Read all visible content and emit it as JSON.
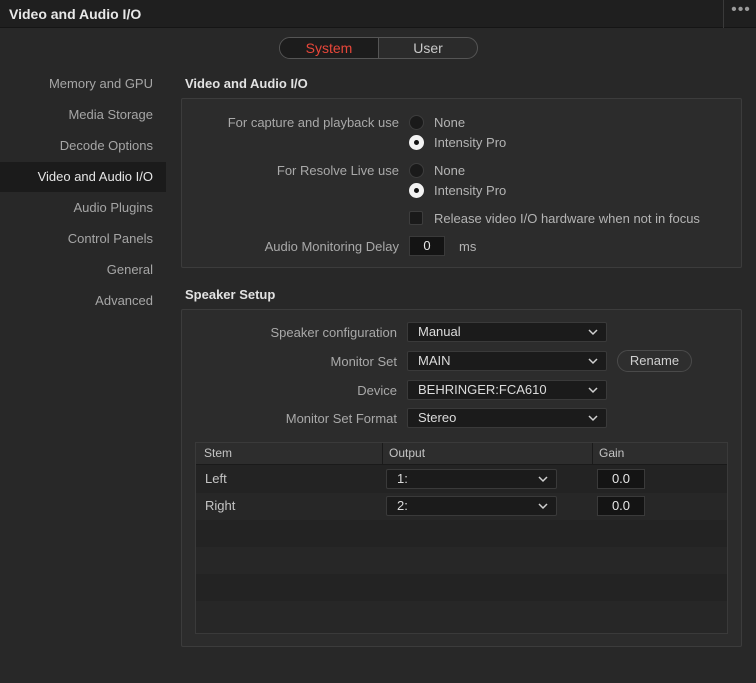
{
  "window": {
    "title": "Video and Audio I/O",
    "more_label": "•••"
  },
  "tabs": {
    "system": "System",
    "user": "User",
    "active": "System"
  },
  "sidebar": {
    "items": [
      {
        "label": "Memory and GPU"
      },
      {
        "label": "Media Storage"
      },
      {
        "label": "Decode Options"
      },
      {
        "label": "Video and Audio I/O",
        "active": true
      },
      {
        "label": "Audio Plugins"
      },
      {
        "label": "Control Panels"
      },
      {
        "label": "General"
      },
      {
        "label": "Advanced"
      }
    ]
  },
  "io": {
    "title": "Video and Audio I/O",
    "capture_label": "For capture and playback use",
    "capture_options": [
      {
        "label": "None",
        "selected": false
      },
      {
        "label": "Intensity Pro",
        "selected": true
      }
    ],
    "live_label": "For Resolve Live use",
    "live_options": [
      {
        "label": "None",
        "selected": false
      },
      {
        "label": "Intensity Pro",
        "selected": true
      }
    ],
    "release_label": "Release video I/O hardware when not in focus",
    "release_checked": false,
    "delay_label": "Audio Monitoring Delay",
    "delay_value": "0",
    "delay_unit": "ms"
  },
  "speaker": {
    "title": "Speaker Setup",
    "config_label": "Speaker configuration",
    "config_value": "Manual",
    "monitor_set_label": "Monitor Set",
    "monitor_set_value": "MAIN",
    "rename_label": "Rename",
    "device_label": "Device",
    "device_value": "BEHRINGER:FCA610",
    "format_label": "Monitor Set Format",
    "format_value": "Stereo",
    "table": {
      "headers": [
        "Stem",
        "Output",
        "Gain"
      ],
      "rows": [
        {
          "stem": "Left",
          "output": "1:",
          "gain": "0.0"
        },
        {
          "stem": "Right",
          "output": "2:",
          "gain": "0.0"
        }
      ]
    }
  },
  "colors": {
    "accent": "#e8473a",
    "background": "#282828",
    "panel": "#2c2c2c"
  }
}
